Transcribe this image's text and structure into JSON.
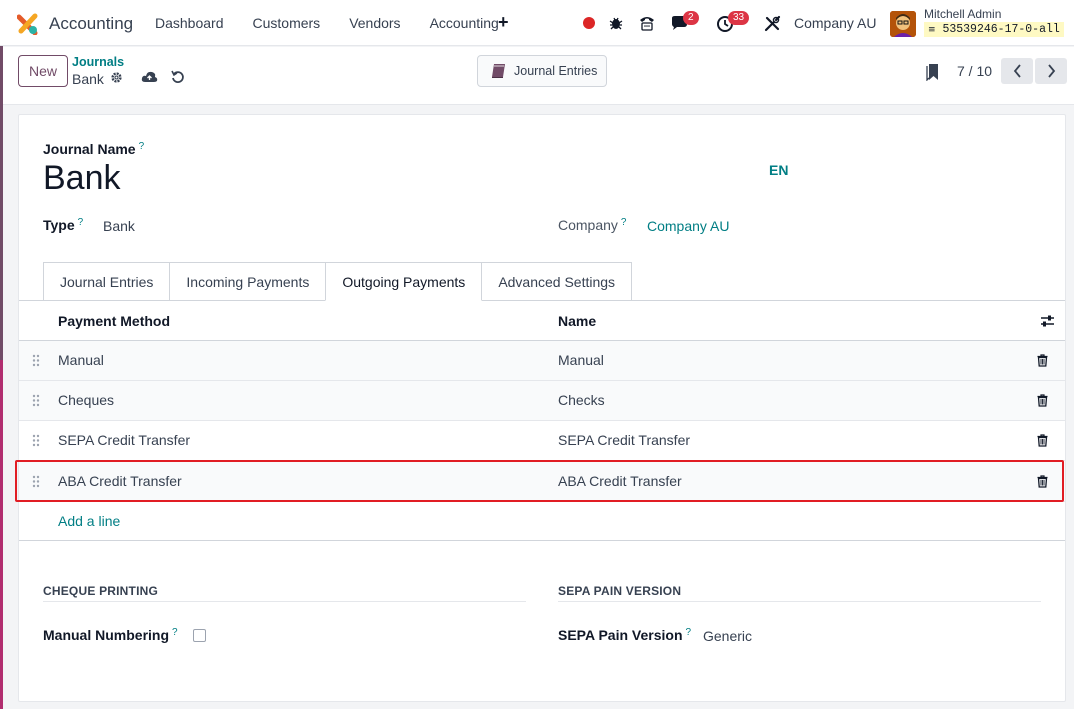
{
  "navbar": {
    "app_name": "Accounting",
    "menu": [
      "Dashboard",
      "Customers",
      "Vendors",
      "Accounting"
    ],
    "messages_count": "2",
    "activities_count": "33",
    "company": "Company AU",
    "user_name": "Mitchell Admin",
    "db_name": "53539246-17-0-all"
  },
  "control": {
    "new_label": "New",
    "breadcrumb_parent": "Journals",
    "breadcrumb_current": "Bank",
    "smart_button_label": "Journal Entries",
    "pager": "7 / 10"
  },
  "form": {
    "journal_name_label": "Journal Name",
    "journal_name": "Bank",
    "language": "EN",
    "type_label": "Type",
    "type_value": "Bank",
    "company_label": "Company",
    "company_value": "Company AU",
    "help_mark": "?"
  },
  "tabs": [
    "Journal Entries",
    "Incoming Payments",
    "Outgoing Payments",
    "Advanced Settings"
  ],
  "table": {
    "headers": [
      "Payment Method",
      "Name"
    ],
    "rows": [
      {
        "method": "Manual",
        "name": "Manual"
      },
      {
        "method": "Cheques",
        "name": "Checks"
      },
      {
        "method": "SEPA Credit Transfer",
        "name": "SEPA Credit Transfer"
      },
      {
        "method": "ABA Credit Transfer",
        "name": "ABA Credit Transfer"
      }
    ],
    "add_line": "Add a line"
  },
  "cheque_printing": {
    "title": "CHEQUE PRINTING",
    "manual_numbering_label": "Manual Numbering"
  },
  "sepa": {
    "title": "SEPA PAIN VERSION",
    "pain_version_label": "SEPA Pain Version",
    "pain_version_value": "Generic"
  },
  "colors": {
    "brand": "#714b67",
    "link": "#017e84",
    "highlight": "#e11d24",
    "badge": "#dc3545"
  }
}
